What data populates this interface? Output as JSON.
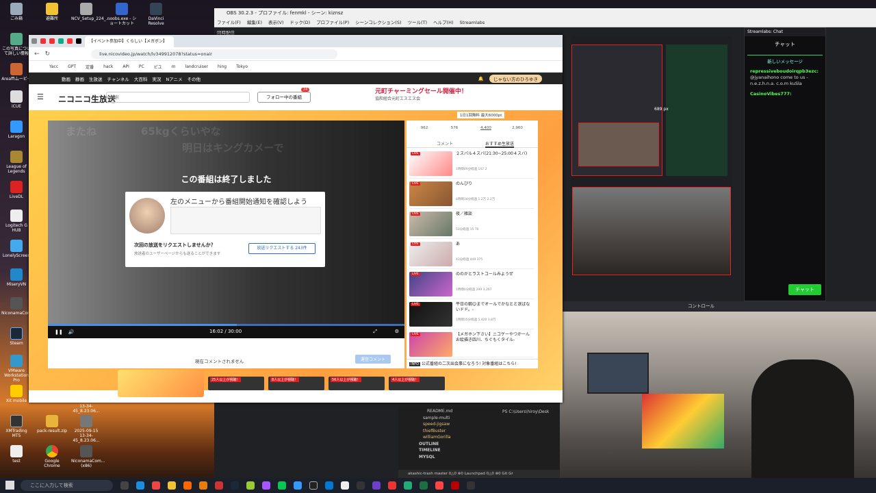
{
  "desktop": {
    "icons": [
      {
        "label": "ごみ箱"
      },
      {
        "label": "この写真について詳しい情報"
      },
      {
        "label": "Areaffiムービー"
      },
      {
        "label": "iCUE"
      },
      {
        "label": "Laragon"
      },
      {
        "label": "League of Legends"
      },
      {
        "label": "LiveDL"
      },
      {
        "label": "Logitech G HUB"
      },
      {
        "label": "LonelyScreen"
      },
      {
        "label": "MiseryVN"
      },
      {
        "label": "NiconamaCom..."
      },
      {
        "label": "Steam"
      },
      {
        "label": "VMware Workstation Pro"
      },
      {
        "label": "Xit mobile"
      },
      {
        "label": "XMTrading MT5"
      },
      {
        "label": "test"
      },
      {
        "label": "避難所"
      },
      {
        "label": "NCV_Setup_224_..."
      },
      {
        "label": "noobs.exe - ショートカット"
      },
      {
        "label": "DaVinci Resolve"
      },
      {
        "label": "13-34-45_8.23.06..."
      },
      {
        "label": "pack-result.zip"
      },
      {
        "label": "2025-09-15 13-34-45_8.23.06..."
      },
      {
        "label": "Google Chrome"
      },
      {
        "label": "NiconamaCom... (x86)"
      }
    ]
  },
  "obs": {
    "title": "OBS 30.2.3 - プロファイル: fenmkl - シーン: kiznsz",
    "menu": [
      "ファイル(F)",
      "編集(E)",
      "表示(V)",
      "ドック(D)",
      "プロファイル(P)",
      "シーンコレクション(S)",
      "ツール(T)",
      "ヘルプ(H)",
      "Streamlabs"
    ],
    "scene_label": "同時配信",
    "preview_size_label": "689 px",
    "dock_label": "コントロール",
    "chat": {
      "header": "Streamlabs: Chat",
      "title": "チャット",
      "new_messages": "新しいメッセージ",
      "messages": [
        {
          "user": "repressiveboudoirqpb3ezc:",
          "text": "@jyanaihono come to us - n.e.z.h.n.a. c.o.m kuSla"
        },
        {
          "user": "CasinoVibes777:",
          "text": ""
        }
      ],
      "button": "チャット"
    }
  },
  "browser": {
    "tab_title": "【イベント参加中】くらしい【メガボン】",
    "url": "live.nicovideo.jp/watch/lv349912078?status=onair",
    "bookmarks": [
      "Yacc",
      "GPT",
      "定番",
      "hack",
      "API",
      "PC",
      "ピユ",
      "m",
      "landcruiser",
      "hing",
      "Tokyo"
    ],
    "nicobar": {
      "items": [
        "動画",
        "静画",
        "生放送",
        "チャンネル",
        "大百科",
        "実況",
        "Nアニメ",
        "その他"
      ],
      "user": "じゃない方のひろゆき"
    }
  },
  "niconico": {
    "logo": "ニコニコ生放送",
    "search_placeholder": "検索",
    "follow_button": "フォロー中の番組",
    "follow_count": "24",
    "ad": {
      "title": "元町チャーミングセール開催中！",
      "subtitle": "協和組合元町エスエス会"
    },
    "ad_note": "1日1回無料 最大6000pt",
    "player": {
      "overlay1": "またね",
      "overlay2": "65kgくらいやな",
      "overlay3": "明日はキングカメーで",
      "ended": "この番組は終了しました",
      "dialog": {
        "title": "左のメニューから番組開始通知を確認しよう",
        "question": "次回の放送をリクエストしませんか？",
        "sub": "放送者のユーザーページからも送ることができます",
        "button": "放送リクエストする 243件"
      },
      "time": "16:02 / 30:00",
      "seek_fraction": 0.53
    },
    "no_comment": "現在コメントされません",
    "comment_button": "運営コメント",
    "sidebar": {
      "stats": [
        "962",
        "576",
        "4,400",
        "2,960"
      ],
      "tabs": [
        "コメント",
        "おすすめ生放送"
      ],
      "items": [
        {
          "title": "２スバル４スバ(21:30~25:00４スバ)",
          "meta": "1時間49分経過   147   2",
          "live": true
        },
        {
          "title": "のんびり",
          "meta": "4時間34分経過   1.2万   2.2万",
          "live": true
        },
        {
          "title": "夜／雑談",
          "meta": "53分経過   15   70",
          "live": true
        },
        {
          "title": "あ",
          "meta": "43分経過   449   375",
          "live": true
        },
        {
          "title": "ののかとラストコールみようぜ",
          "meta": "1時間0分経過   299   3,267",
          "live": true
        },
        {
          "title": "平日の朝😊までオールでかなとと涙ばないドド。-",
          "meta": "1時間15分経過   5,420   1.8万",
          "live": true
        },
        {
          "title": "【メガホン下さい】ニコゲーやつかーんお絵描き四川、ちぐもくタイル-",
          "meta": "",
          "live": true
        }
      ],
      "info": "公式番組の二次出会事になろう! 対象番組はこちら!"
    },
    "ranking": [
      "25人以上が視聴！",
      "8人以上が視聴！",
      "56人以上が視聴！",
      "4人以上が視聴！"
    ]
  },
  "vscode": {
    "files": [
      "README.md",
      "sample-multi",
      "speed-jigsaw",
      "thiefBuster",
      "williamGorilla"
    ],
    "sections": [
      "OUTLINE",
      "TIMELINE",
      "MYSQL"
    ],
    "terminal": "PS C:\\Users\\hiroy\\Desk",
    "status": "akashic-trash   master   0△0 ⊗0   Launchpad   0△0 ⊗0   Git Gr"
  },
  "taskbar": {
    "search_placeholder": "ここに入力して検索"
  }
}
